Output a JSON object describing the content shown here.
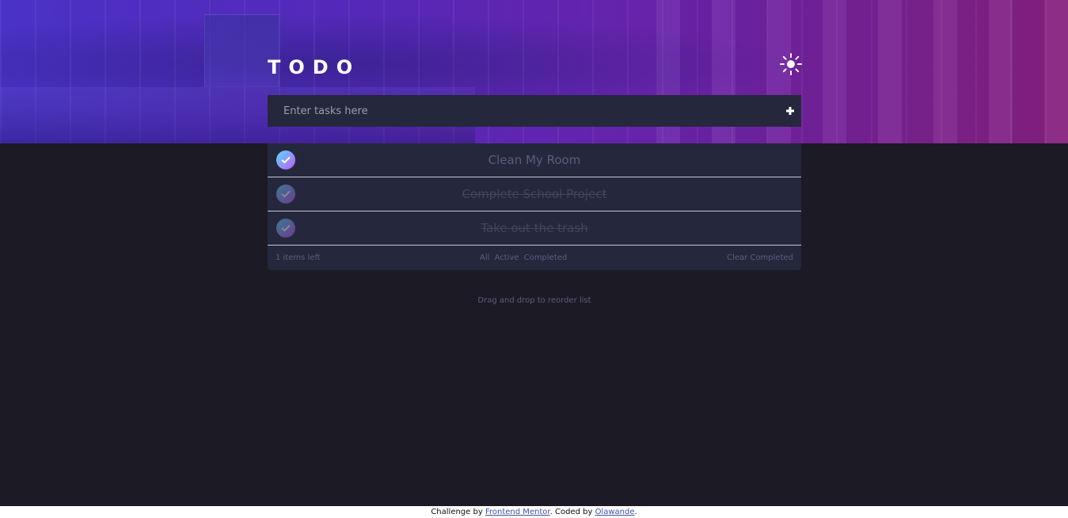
{
  "header": {
    "title": "TODO",
    "theme_icon": "sun-icon"
  },
  "new_task": {
    "placeholder": "Enter tasks here",
    "value": "",
    "add_icon": "plus-icon"
  },
  "todos": [
    {
      "text": "Clean My Room",
      "completed": false
    },
    {
      "text": "Complete School Project",
      "completed": true
    },
    {
      "text": "Take out the trash",
      "completed": true
    }
  ],
  "footer": {
    "items_left": "1 items left",
    "filters": [
      "All",
      "Active",
      "Completed"
    ],
    "clear_label": "Clear Completed"
  },
  "drag_hint": "Drag and drop to reorder list",
  "attribution": {
    "prefix": "Challenge by",
    "link1": "Frontend Mentor",
    "middle": ". Coded by",
    "link2": "Olawande",
    "suffix": "."
  },
  "colors": {
    "background": "#1b1a25",
    "card": "#25273c",
    "check_gradient_start": "#57ddff",
    "check_gradient_end": "#c058f3",
    "muted_text": "#5b5e7e",
    "link": "#3e52a3"
  }
}
